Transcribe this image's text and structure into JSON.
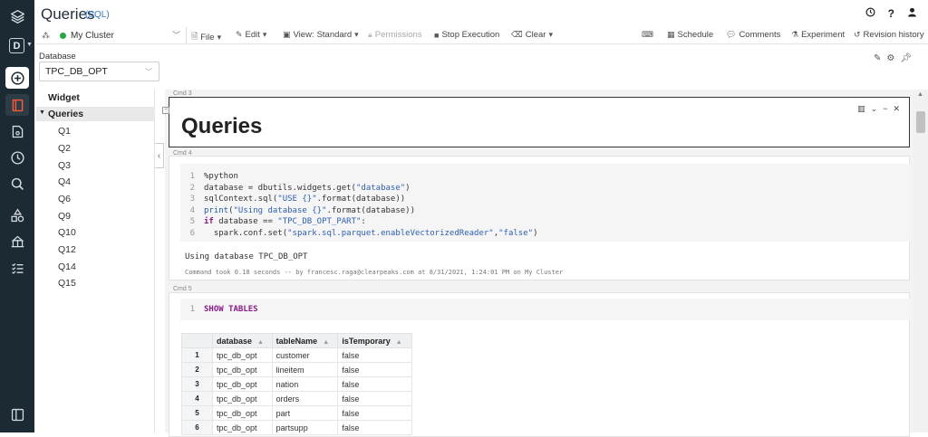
{
  "header": {
    "title": "Queries",
    "language": "(SQL)",
    "icons": [
      "clock-icon",
      "help-icon",
      "user-icon"
    ],
    "help_label": "?"
  },
  "sidebar": {
    "workspace_letter": "D",
    "items": [
      "layers-icon",
      "workspace-icon",
      "create-icon",
      "notebook-icon",
      "repos-icon",
      "recents-icon",
      "search-icon",
      "shapes-icon",
      "hierarchy-icon",
      "checklist-icon",
      "panel-toggle-icon"
    ]
  },
  "toolbar": {
    "cluster": "My Cluster",
    "file": "File",
    "edit": "Edit",
    "view": "View:",
    "view_mode": "Standard",
    "permissions": "Permissions",
    "stop": "Stop Execution",
    "clear": "Clear",
    "schedule": "Schedule",
    "comments": "Comments",
    "experiment": "Experiment",
    "revision": "Revision history"
  },
  "widget": {
    "label": "Database",
    "value": "TPC_DB_OPT"
  },
  "outline": {
    "header": "Widget",
    "section": "Queries",
    "items": [
      "Q1",
      "Q2",
      "Q3",
      "Q4",
      "Q6",
      "Q9",
      "Q10",
      "Q12",
      "Q14",
      "Q15"
    ]
  },
  "cells": {
    "cmd3": {
      "label": "Cmd 3",
      "heading": "Queries"
    },
    "cmd4": {
      "label": "Cmd 4",
      "line_numbers": [
        "1",
        "2",
        "3",
        "4",
        "5",
        "6"
      ],
      "line1": "%python",
      "line2_a": "database = dbutils.widgets.get(",
      "line2_s": "\"database\"",
      "line2_b": ")",
      "line3_a": "sqlContext.sql(",
      "line3_s": "\"USE {}\"",
      "line3_b": ".format(database))",
      "line4_f": "print",
      "line4_a": "(",
      "line4_s": "\"Using database {}\"",
      "line4_b": ".format(database))",
      "line5_k": "if",
      "line5_a": " database == ",
      "line5_s": "\"TPC_DB_OPT_PART\"",
      "line5_b": ":",
      "line6_a": "  spark.conf.set(",
      "line6_s1": "\"spark.sql.parquet.enableVectorizedReader\"",
      "line6_c": ",",
      "line6_s2": "\"false\"",
      "line6_b": ")",
      "output": "Using database TPC_DB_OPT",
      "took": "Command took 0.18 seconds -- by francesc.raga@clearpeaks.com at 8/31/2021, 1:24:01 PM on My Cluster"
    },
    "cmd5": {
      "label": "Cmd 5",
      "line_number": "1",
      "code": "SHOW TABLES"
    }
  },
  "results": {
    "columns": [
      "database",
      "tableName",
      "isTemporary"
    ],
    "rows": [
      {
        "n": "1",
        "database": "tpc_db_opt",
        "tableName": "customer",
        "isTemporary": "false"
      },
      {
        "n": "2",
        "database": "tpc_db_opt",
        "tableName": "lineitem",
        "isTemporary": "false"
      },
      {
        "n": "3",
        "database": "tpc_db_opt",
        "tableName": "nation",
        "isTemporary": "false"
      },
      {
        "n": "4",
        "database": "tpc_db_opt",
        "tableName": "orders",
        "isTemporary": "false"
      },
      {
        "n": "5",
        "database": "tpc_db_opt",
        "tableName": "part",
        "isTemporary": "false"
      },
      {
        "n": "6",
        "database": "tpc_db_opt",
        "tableName": "partsupp",
        "isTemporary": "false"
      }
    ]
  },
  "colors": {
    "sidebar_bg": "#1b2a33",
    "cluster_status": "#27a745",
    "link_blue": "#2f7bd1",
    "keyword": "#8a1a8a",
    "string": "#2c5fbd"
  }
}
